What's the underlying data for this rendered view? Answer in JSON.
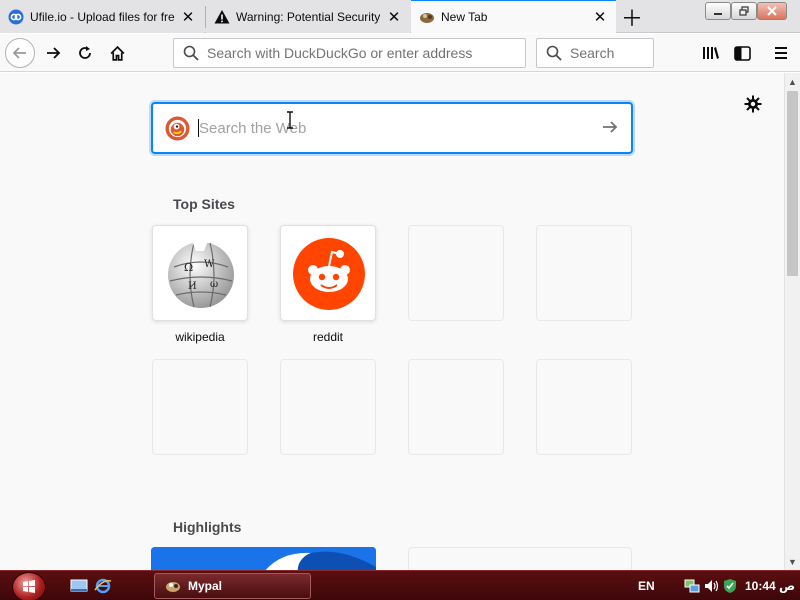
{
  "tabs": [
    {
      "title": "Ufile.io - Upload files for fre",
      "icon": "ufile-icon",
      "active": false
    },
    {
      "title": "Warning: Potential Security",
      "icon": "warning-icon",
      "active": false
    },
    {
      "title": "New Tab",
      "icon": "firefox-icon",
      "active": true
    }
  ],
  "toolbar": {
    "url_placeholder": "Search with DuckDuckGo or enter address",
    "search_placeholder": "Search"
  },
  "newtab": {
    "websearch_placeholder": "Search the Web",
    "top_sites_title": "Top Sites",
    "top_sites": [
      {
        "label": "wikipedia",
        "icon": "wikipedia-icon"
      },
      {
        "label": "reddit",
        "icon": "reddit-icon"
      }
    ],
    "highlights_title": "Highlights"
  },
  "taskbar": {
    "task_label": "Mypal",
    "language": "EN",
    "clock": "10:44 ص"
  },
  "colors": {
    "accent": "#0a84ff",
    "reddit": "#ff4500",
    "taskbar": "#4a0a0d"
  }
}
